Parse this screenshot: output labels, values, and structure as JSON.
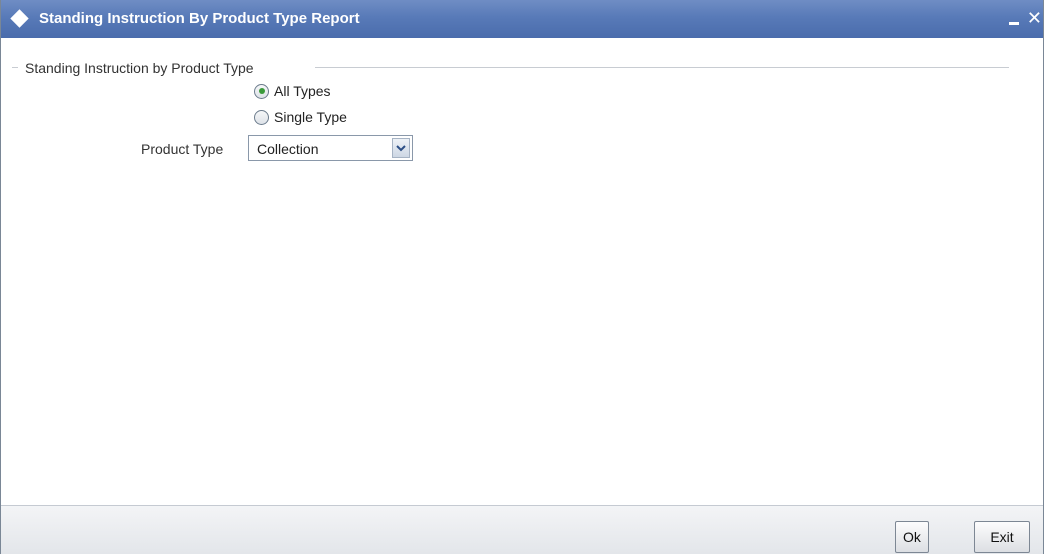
{
  "window": {
    "title": "Standing Instruction By Product Type Report",
    "minimize_glyph": "",
    "close_glyph": "✕"
  },
  "group": {
    "legend": "Standing Instruction by Product Type"
  },
  "options": {
    "all_types": {
      "label": "All Types",
      "checked": true
    },
    "single_type": {
      "label": "Single Type",
      "checked": false
    }
  },
  "product_type": {
    "label": "Product Type",
    "selected": "Collection"
  },
  "footer": {
    "ok_label": "Ok",
    "exit_label": "Exit"
  },
  "colors": {
    "titlebar": "#587ab8",
    "radio_dot": "#3a9a3a"
  }
}
